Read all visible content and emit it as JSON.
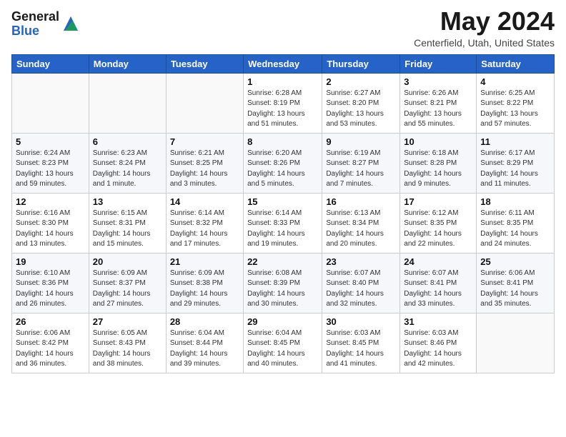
{
  "header": {
    "logo_general": "General",
    "logo_blue": "Blue",
    "month_year": "May 2024",
    "location": "Centerfield, Utah, United States"
  },
  "days_of_week": [
    "Sunday",
    "Monday",
    "Tuesday",
    "Wednesday",
    "Thursday",
    "Friday",
    "Saturday"
  ],
  "weeks": [
    [
      {
        "day": "",
        "info": ""
      },
      {
        "day": "",
        "info": ""
      },
      {
        "day": "",
        "info": ""
      },
      {
        "day": "1",
        "info": "Sunrise: 6:28 AM\nSunset: 8:19 PM\nDaylight: 13 hours\nand 51 minutes."
      },
      {
        "day": "2",
        "info": "Sunrise: 6:27 AM\nSunset: 8:20 PM\nDaylight: 13 hours\nand 53 minutes."
      },
      {
        "day": "3",
        "info": "Sunrise: 6:26 AM\nSunset: 8:21 PM\nDaylight: 13 hours\nand 55 minutes."
      },
      {
        "day": "4",
        "info": "Sunrise: 6:25 AM\nSunset: 8:22 PM\nDaylight: 13 hours\nand 57 minutes."
      }
    ],
    [
      {
        "day": "5",
        "info": "Sunrise: 6:24 AM\nSunset: 8:23 PM\nDaylight: 13 hours\nand 59 minutes."
      },
      {
        "day": "6",
        "info": "Sunrise: 6:23 AM\nSunset: 8:24 PM\nDaylight: 14 hours\nand 1 minute."
      },
      {
        "day": "7",
        "info": "Sunrise: 6:21 AM\nSunset: 8:25 PM\nDaylight: 14 hours\nand 3 minutes."
      },
      {
        "day": "8",
        "info": "Sunrise: 6:20 AM\nSunset: 8:26 PM\nDaylight: 14 hours\nand 5 minutes."
      },
      {
        "day": "9",
        "info": "Sunrise: 6:19 AM\nSunset: 8:27 PM\nDaylight: 14 hours\nand 7 minutes."
      },
      {
        "day": "10",
        "info": "Sunrise: 6:18 AM\nSunset: 8:28 PM\nDaylight: 14 hours\nand 9 minutes."
      },
      {
        "day": "11",
        "info": "Sunrise: 6:17 AM\nSunset: 8:29 PM\nDaylight: 14 hours\nand 11 minutes."
      }
    ],
    [
      {
        "day": "12",
        "info": "Sunrise: 6:16 AM\nSunset: 8:30 PM\nDaylight: 14 hours\nand 13 minutes."
      },
      {
        "day": "13",
        "info": "Sunrise: 6:15 AM\nSunset: 8:31 PM\nDaylight: 14 hours\nand 15 minutes."
      },
      {
        "day": "14",
        "info": "Sunrise: 6:14 AM\nSunset: 8:32 PM\nDaylight: 14 hours\nand 17 minutes."
      },
      {
        "day": "15",
        "info": "Sunrise: 6:14 AM\nSunset: 8:33 PM\nDaylight: 14 hours\nand 19 minutes."
      },
      {
        "day": "16",
        "info": "Sunrise: 6:13 AM\nSunset: 8:34 PM\nDaylight: 14 hours\nand 20 minutes."
      },
      {
        "day": "17",
        "info": "Sunrise: 6:12 AM\nSunset: 8:35 PM\nDaylight: 14 hours\nand 22 minutes."
      },
      {
        "day": "18",
        "info": "Sunrise: 6:11 AM\nSunset: 8:35 PM\nDaylight: 14 hours\nand 24 minutes."
      }
    ],
    [
      {
        "day": "19",
        "info": "Sunrise: 6:10 AM\nSunset: 8:36 PM\nDaylight: 14 hours\nand 26 minutes."
      },
      {
        "day": "20",
        "info": "Sunrise: 6:09 AM\nSunset: 8:37 PM\nDaylight: 14 hours\nand 27 minutes."
      },
      {
        "day": "21",
        "info": "Sunrise: 6:09 AM\nSunset: 8:38 PM\nDaylight: 14 hours\nand 29 minutes."
      },
      {
        "day": "22",
        "info": "Sunrise: 6:08 AM\nSunset: 8:39 PM\nDaylight: 14 hours\nand 30 minutes."
      },
      {
        "day": "23",
        "info": "Sunrise: 6:07 AM\nSunset: 8:40 PM\nDaylight: 14 hours\nand 32 minutes."
      },
      {
        "day": "24",
        "info": "Sunrise: 6:07 AM\nSunset: 8:41 PM\nDaylight: 14 hours\nand 33 minutes."
      },
      {
        "day": "25",
        "info": "Sunrise: 6:06 AM\nSunset: 8:41 PM\nDaylight: 14 hours\nand 35 minutes."
      }
    ],
    [
      {
        "day": "26",
        "info": "Sunrise: 6:06 AM\nSunset: 8:42 PM\nDaylight: 14 hours\nand 36 minutes."
      },
      {
        "day": "27",
        "info": "Sunrise: 6:05 AM\nSunset: 8:43 PM\nDaylight: 14 hours\nand 38 minutes."
      },
      {
        "day": "28",
        "info": "Sunrise: 6:04 AM\nSunset: 8:44 PM\nDaylight: 14 hours\nand 39 minutes."
      },
      {
        "day": "29",
        "info": "Sunrise: 6:04 AM\nSunset: 8:45 PM\nDaylight: 14 hours\nand 40 minutes."
      },
      {
        "day": "30",
        "info": "Sunrise: 6:03 AM\nSunset: 8:45 PM\nDaylight: 14 hours\nand 41 minutes."
      },
      {
        "day": "31",
        "info": "Sunrise: 6:03 AM\nSunset: 8:46 PM\nDaylight: 14 hours\nand 42 minutes."
      },
      {
        "day": "",
        "info": ""
      }
    ]
  ]
}
